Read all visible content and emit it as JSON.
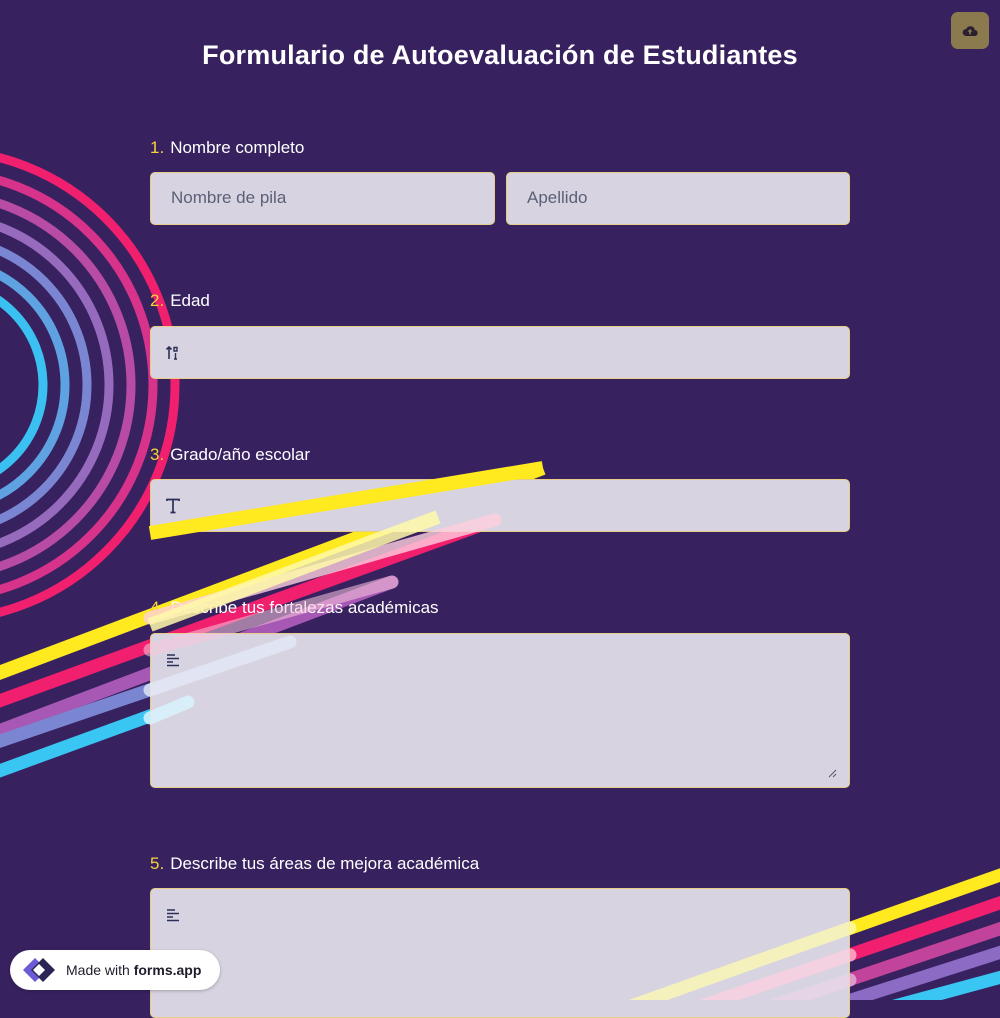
{
  "header": {
    "title": "Formulario de Autoevaluación de Estudiantes",
    "save_icon": "cloud-upload-icon"
  },
  "questions": [
    {
      "number": "1.",
      "label": "Nombre completo",
      "fields": [
        {
          "placeholder": "Nombre de pila"
        },
        {
          "placeholder": "Apellido"
        }
      ]
    },
    {
      "number": "2.",
      "label": "Edad",
      "icon": "number-input-icon"
    },
    {
      "number": "3.",
      "label": "Grado/año escolar",
      "icon": "text-input-icon"
    },
    {
      "number": "4.",
      "label": "Describe tus fortalezas académicas",
      "icon": "paragraph-icon"
    },
    {
      "number": "5.",
      "label": "Describe tus áreas de mejora académica",
      "icon": "paragraph-icon"
    }
  ],
  "footer": {
    "made_with": "Made with",
    "brand": "forms.app"
  },
  "colors": {
    "background": "#38215f",
    "accent_number": "#f7d33a",
    "field_bg": "#d7d3e0",
    "stripes": [
      "#f0206e",
      "#c2449a",
      "#8b6bc4",
      "#4fb2e6",
      "#39c6f3",
      "#ffe91f"
    ]
  }
}
